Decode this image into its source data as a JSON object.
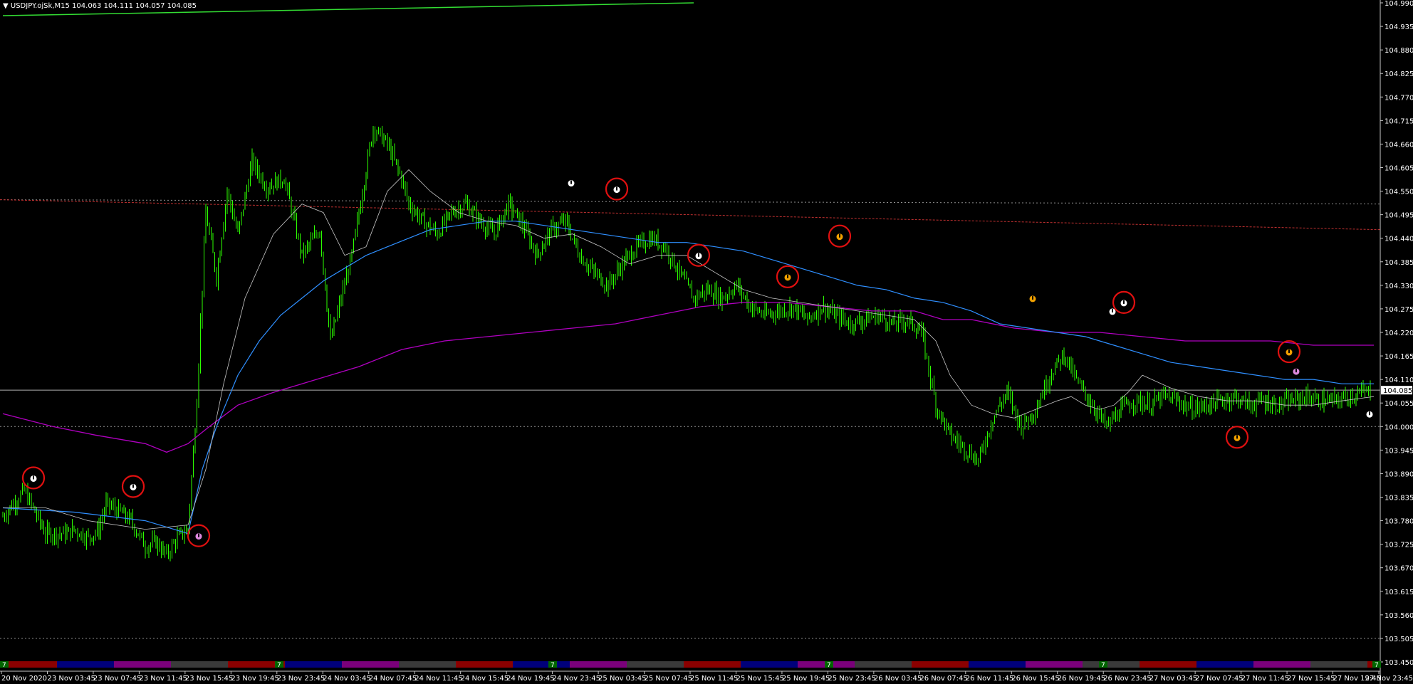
{
  "window": {
    "symbol_title": "USDJPY.ojSk,M15",
    "ohlc": "104.063 104.111 104.057 104.085",
    "title_arrow": "▼"
  },
  "colors": {
    "background": "#000000",
    "candles": "#2cff00",
    "ma_fast": "#c8c8c8",
    "ma_blue": "#2f8fff",
    "ma_purple": "#b000c0",
    "trend_green": "#33dd33",
    "red_level": "#c03030",
    "circle": "#e01010",
    "bid_line": "#b0b0b0"
  },
  "price_axis": {
    "labels": [
      "104.990",
      "104.935",
      "104.880",
      "104.825",
      "104.770",
      "104.715",
      "104.660",
      "104.605",
      "104.550",
      "104.495",
      "104.440",
      "104.385",
      "104.330",
      "104.275",
      "104.220",
      "104.165",
      "104.110",
      "104.055",
      "104.000",
      "103.945",
      "103.890",
      "103.835",
      "103.780",
      "103.725",
      "103.670",
      "103.615",
      "103.560",
      "103.505",
      "103.450"
    ],
    "current_price": "104.085"
  },
  "time_axis": {
    "labels": [
      "20 Nov 2020",
      "23 Nov 03:45",
      "23 Nov 07:45",
      "23 Nov 11:45",
      "23 Nov 15:45",
      "23 Nov 19:45",
      "23 Nov 23:45",
      "24 Nov 03:45",
      "24 Nov 07:45",
      "24 Nov 11:45",
      "24 Nov 15:45",
      "24 Nov 19:45",
      "24 Nov 23:45",
      "25 Nov 03:45",
      "25 Nov 07:45",
      "25 Nov 11:45",
      "25 Nov 15:45",
      "25 Nov 19:45",
      "25 Nov 23:45",
      "26 Nov 03:45",
      "26 Nov 07:45",
      "26 Nov 11:45",
      "26 Nov 15:45",
      "26 Nov 19:45",
      "26 Nov 23:45",
      "27 Nov 03:45",
      "27 Nov 07:45",
      "27 Nov 11:45",
      "27 Nov 15:45",
      "27 Nov 19:45",
      "27 Nov 23:45"
    ]
  },
  "session_bar": {
    "marker": "7",
    "segment_colors": [
      "#8b0000",
      "#00007a",
      "#7a007a",
      "#3a3a3a"
    ]
  },
  "chart_data": {
    "type": "line",
    "ylim": [
      103.45,
      104.99
    ],
    "price_series": {
      "x": [
        0,
        30,
        45,
        60,
        90,
        100,
        120,
        135,
        145,
        165,
        180,
        200,
        215,
        230,
        245,
        260,
        272,
        285,
        300,
        315,
        330,
        350,
        370,
        395,
        420,
        445,
        460,
        475,
        490,
        510,
        520,
        540,
        560,
        570,
        590,
        610,
        630,
        650,
        670,
        690,
        710,
        730,
        750,
        770,
        790,
        810,
        830,
        850,
        870,
        890,
        910,
        930,
        950,
        970,
        990,
        1010,
        1030,
        1050,
        1070,
        1090,
        1110,
        1130,
        1150,
        1170,
        1190,
        1210,
        1230,
        1250,
        1270,
        1290,
        1310,
        1330,
        1350,
        1370,
        1390,
        1410,
        1430,
        1450,
        1470,
        1490,
        1510,
        1530,
        1550,
        1570,
        1590,
        1610,
        1630,
        1650,
        1670,
        1690,
        1710,
        1730,
        1750,
        1770,
        1790,
        1810,
        1830,
        1850,
        1870,
        1890,
        1910,
        1925
      ],
      "y": [
        103.79,
        103.85,
        103.8,
        103.75,
        103.75,
        103.76,
        103.74,
        103.76,
        103.82,
        103.8,
        103.78,
        103.72,
        103.73,
        103.7,
        103.74,
        103.76,
        104.05,
        104.5,
        104.35,
        104.55,
        104.45,
        104.62,
        104.56,
        104.58,
        104.4,
        104.46,
        104.2,
        104.3,
        104.4,
        104.6,
        104.7,
        104.66,
        104.58,
        104.52,
        104.48,
        104.45,
        104.5,
        104.52,
        104.48,
        104.45,
        104.52,
        104.47,
        104.4,
        104.46,
        104.48,
        104.4,
        104.36,
        104.33,
        104.38,
        104.42,
        104.44,
        104.42,
        104.36,
        104.3,
        104.32,
        104.3,
        104.33,
        104.28,
        104.26,
        104.27,
        104.28,
        104.25,
        104.28,
        104.26,
        104.24,
        104.25,
        104.26,
        104.24,
        104.25,
        104.22,
        104.05,
        103.98,
        103.95,
        103.92,
        104.02,
        104.08,
        104.0,
        104.04,
        104.12,
        104.17,
        104.1,
        104.05,
        104.0,
        104.04,
        104.06,
        104.05,
        104.07,
        104.06,
        104.04,
        104.05,
        104.06,
        104.07,
        104.05,
        104.06,
        104.05,
        104.06,
        104.07,
        104.06,
        104.06,
        104.07,
        104.08,
        104.085
      ]
    },
    "ma_fast": {
      "x": [
        0,
        60,
        120,
        200,
        260,
        285,
        310,
        340,
        380,
        420,
        450,
        480,
        510,
        540,
        570,
        600,
        640,
        680,
        720,
        760,
        800,
        840,
        880,
        920,
        960,
        1000,
        1040,
        1080,
        1120,
        1160,
        1200,
        1240,
        1280,
        1310,
        1330,
        1360,
        1390,
        1420,
        1450,
        1480,
        1500,
        1520,
        1540,
        1560,
        1580,
        1600,
        1640,
        1680,
        1720,
        1760,
        1800,
        1840,
        1880,
        1925
      ],
      "y": [
        103.81,
        103.81,
        103.78,
        103.76,
        103.77,
        103.9,
        104.1,
        104.3,
        104.45,
        104.52,
        104.5,
        104.4,
        104.42,
        104.55,
        104.6,
        104.55,
        104.5,
        104.48,
        104.47,
        104.44,
        104.45,
        104.42,
        104.38,
        104.4,
        104.4,
        104.36,
        104.32,
        104.3,
        104.29,
        104.28,
        104.27,
        104.26,
        104.25,
        104.2,
        104.12,
        104.05,
        104.03,
        104.02,
        104.04,
        104.06,
        104.07,
        104.05,
        104.04,
        104.05,
        104.08,
        104.12,
        104.09,
        104.07,
        104.06,
        104.06,
        104.05,
        104.05,
        104.06,
        104.07
      ]
    },
    "ma_blue": {
      "x": [
        0,
        100,
        200,
        260,
        280,
        300,
        330,
        360,
        390,
        420,
        450,
        480,
        510,
        540,
        570,
        600,
        640,
        680,
        720,
        760,
        800,
        840,
        880,
        920,
        960,
        1000,
        1040,
        1080,
        1120,
        1160,
        1200,
        1240,
        1280,
        1320,
        1360,
        1400,
        1440,
        1480,
        1520,
        1560,
        1600,
        1640,
        1680,
        1720,
        1760,
        1800,
        1840,
        1880,
        1925
      ],
      "y": [
        103.81,
        103.8,
        103.78,
        103.75,
        103.9,
        104.0,
        104.12,
        104.2,
        104.26,
        104.3,
        104.34,
        104.37,
        104.4,
        104.42,
        104.44,
        104.46,
        104.47,
        104.48,
        104.48,
        104.47,
        104.46,
        104.45,
        104.44,
        104.43,
        104.43,
        104.42,
        104.41,
        104.39,
        104.37,
        104.35,
        104.33,
        104.32,
        104.3,
        104.29,
        104.27,
        104.24,
        104.23,
        104.22,
        104.21,
        104.19,
        104.17,
        104.15,
        104.14,
        104.13,
        104.12,
        104.11,
        104.11,
        104.1,
        104.1
      ]
    },
    "ma_purple": {
      "x": [
        0,
        70,
        130,
        200,
        230,
        260,
        290,
        330,
        380,
        420,
        460,
        500,
        560,
        620,
        680,
        740,
        800,
        860,
        920,
        980,
        1040,
        1100,
        1160,
        1220,
        1280,
        1320,
        1360,
        1420,
        1480,
        1540,
        1600,
        1660,
        1720,
        1780,
        1840,
        1925
      ],
      "y": [
        104.03,
        104.0,
        103.98,
        103.96,
        103.94,
        103.96,
        104.0,
        104.05,
        104.08,
        104.1,
        104.12,
        104.14,
        104.18,
        104.2,
        104.21,
        104.22,
        104.23,
        104.24,
        104.26,
        104.28,
        104.29,
        104.29,
        104.28,
        104.27,
        104.27,
        104.25,
        104.25,
        104.23,
        104.22,
        104.22,
        104.21,
        104.2,
        104.2,
        104.2,
        104.19,
        104.19
      ]
    },
    "levels": {
      "bid": 104.085,
      "dotted_gray_upper": 104.53,
      "dotted_gray_lower": 104.0,
      "red_level_start": 104.53,
      "red_level_end": 104.46,
      "bottom_dotted": 103.505
    },
    "trend_line": {
      "x": [
        0,
        970
      ],
      "y": [
        104.96,
        104.99
      ]
    },
    "annotated_signals": [
      {
        "x": 43,
        "y": 103.88,
        "color": "#ffffff",
        "circled": true
      },
      {
        "x": 183,
        "y": 103.86,
        "color": "#ffffff",
        "circled": true
      },
      {
        "x": 275,
        "y": 103.745,
        "color": "#dd88dd",
        "circled": true
      },
      {
        "x": 798,
        "y": 104.57,
        "color": "#ffffff",
        "circled": false
      },
      {
        "x": 862,
        "y": 104.555,
        "color": "#ffffff",
        "circled": true
      },
      {
        "x": 977,
        "y": 104.4,
        "color": "#ffffff",
        "circled": true
      },
      {
        "x": 1102,
        "y": 104.35,
        "color": "#f0a000",
        "circled": true
      },
      {
        "x": 1175,
        "y": 104.445,
        "color": "#f0a000",
        "circled": true
      },
      {
        "x": 1446,
        "y": 104.3,
        "color": "#f0a000",
        "circled": false
      },
      {
        "x": 1558,
        "y": 104.27,
        "color": "#ffffff",
        "circled": false
      },
      {
        "x": 1574,
        "y": 104.29,
        "color": "#ffffff",
        "circled": true
      },
      {
        "x": 1733,
        "y": 103.975,
        "color": "#f0a000",
        "circled": true
      },
      {
        "x": 1806,
        "y": 104.175,
        "color": "#f0a000",
        "circled": true
      },
      {
        "x": 1816,
        "y": 104.13,
        "color": "#dd88dd",
        "circled": false
      },
      {
        "x": 1919,
        "y": 104.03,
        "color": "#ffffff",
        "circled": false
      }
    ]
  }
}
